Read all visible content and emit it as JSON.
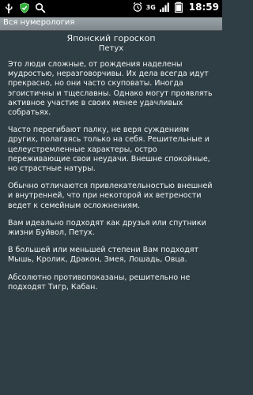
{
  "statusbar": {
    "time": "18:59",
    "network": "3G",
    "icons": [
      "usb-icon",
      "shield-icon",
      "search-icon",
      "alarm-icon",
      "signal-icon",
      "battery-icon"
    ]
  },
  "app": {
    "title": "Вся нумерология"
  },
  "header": {
    "title": "Японский гороскоп",
    "subtitle": "Петух"
  },
  "paragraphs": [
    "Это люди сложные, от рождения наделены мудростью, неразговорчивы. Их дела всегда идут прекрасно, но они часто скуповаты. Иногда эгоистичны и тщеславны. Однако могут проявлять активное участие в своих менее удачливых собратьях.",
    "Часто перегибают палку, не веря суждениям других, полагаясь только на себя. Решительные и целеустремленные характеры, остро переживающие свои неудачи. Внешне спокойные, но страстные натуры.",
    "Обычно отличаются привлекательностью внешней и внутренней, что при некоторой их ветрености ведет к семейным осложнениям.",
    "Вам идеально подходят как друзья или спутники жизни Буйвол, Петух.",
    "В большей или меньшей степени Вам подходят Мышь, Кролик, Дракон, Змея, Лошадь, Овца.",
    "Абсолютно противопоказаны, решительно не подходят Тигр, Кабан."
  ]
}
